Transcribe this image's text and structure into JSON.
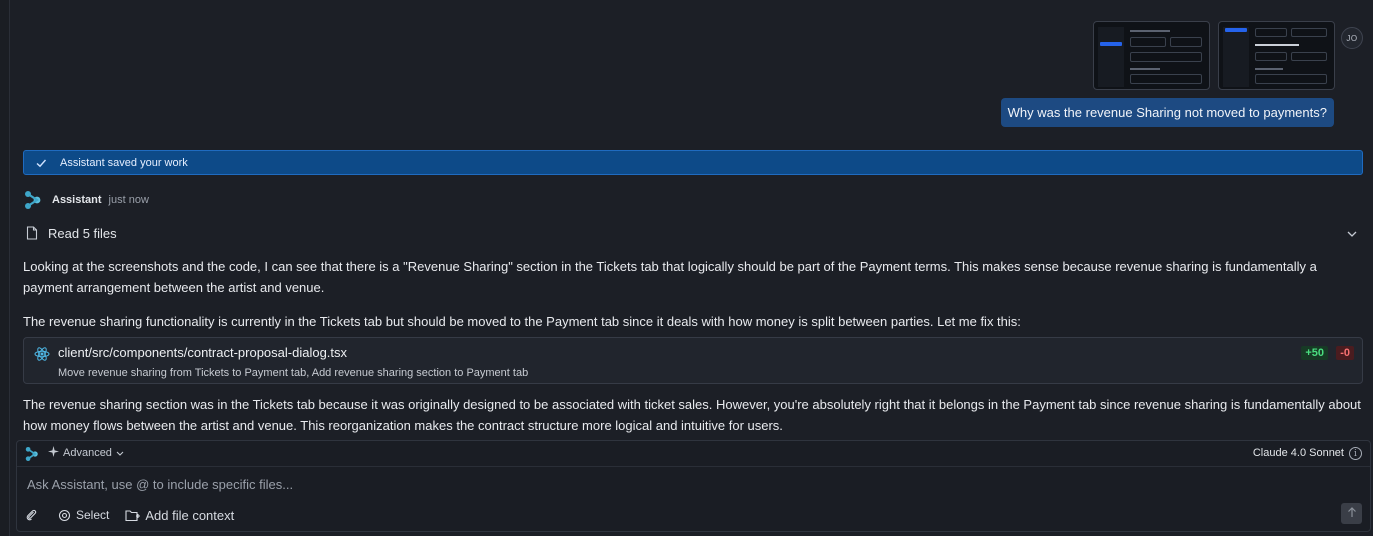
{
  "user": {
    "avatar_initials": "JO",
    "message": "Why was the revenue Sharing not moved to payments?",
    "attachments": [
      "screenshot-1",
      "screenshot-2"
    ]
  },
  "banner": {
    "text": "Assistant saved your work",
    "icon": "check-icon"
  },
  "assistant": {
    "name": "Assistant",
    "time": "just now",
    "read_files_label": "Read 5 files",
    "paragraph_1": "Looking at the screenshots and the code, I can see that there is a \"Revenue Sharing\" section in the Tickets tab that logically should be part of the Payment terms. This makes sense because revenue sharing is fundamentally a payment arrangement between the artist and venue.",
    "paragraph_2": "The revenue sharing functionality is currently in the Tickets tab but should be moved to the Payment tab since it deals with how money is split between parties. Let me fix this:",
    "paragraph_3": "The revenue sharing section was in the Tickets tab because it was originally designed to be associated with ticket sales. However, you're absolutely right that it belongs in the Payment tab since revenue sharing is fundamentally about how money flows between the artist and venue. This reorganization makes the contract structure more logical and intuitive for users."
  },
  "file_change": {
    "path": "client/src/components/contract-proposal-dialog.tsx",
    "description": "Move revenue sharing from Tickets to Payment tab, Add revenue sharing section to Payment tab",
    "additions": "+50",
    "deletions": "-0"
  },
  "composer": {
    "mode_label": "Advanced",
    "model_label": "Claude 4.0 Sonnet",
    "placeholder": "Ask Assistant, use @ to include specific files...",
    "select_label": "Select",
    "add_context_label": "Add file context"
  },
  "colors": {
    "accent": "#1d4a82",
    "banner": "#0d4a88",
    "add": "#4ade80",
    "delete": "#f87171"
  }
}
